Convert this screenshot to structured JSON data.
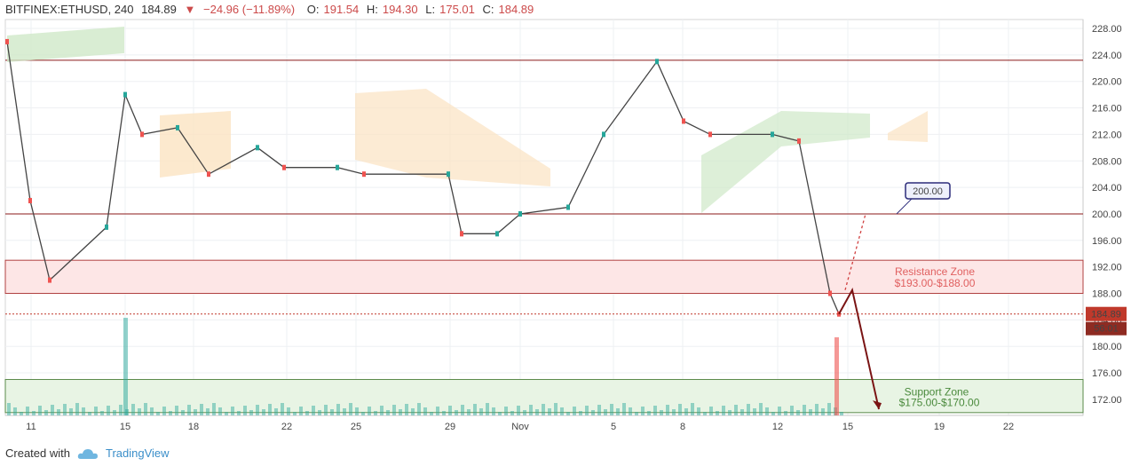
{
  "header": {
    "symbol": "BITFINEX:ETHUSD, 240",
    "last": "184.89",
    "change": "−24.96 (−11.89%)",
    "o_label": "O:",
    "o": "191.54",
    "h_label": "H:",
    "h": "194.30",
    "l_label": "L:",
    "l": "175.01",
    "c_label": "C:",
    "c": "184.89"
  },
  "footer": {
    "created_with": "Created with",
    "brand": "TradingView"
  },
  "colors": {
    "up": "#26a69a",
    "down": "#ef5350",
    "resistance_fill": "#fde6e6",
    "resistance_text": "#e06060",
    "support_fill": "#e8f4e4",
    "support_text": "#4a8a3c",
    "hline": "#8b1a1a",
    "price_tag": "#c0392b",
    "label_box": "#2b2b7a",
    "cloud_green": "#cfe8c8",
    "cloud_orange": "#fbe3c2"
  },
  "chart_data": {
    "type": "line",
    "title": "BITFINEX:ETHUSD, 240",
    "price_range": [
      168,
      229
    ],
    "y_ticks": [
      "228.00",
      "224.00",
      "220.00",
      "216.00",
      "212.00",
      "208.00",
      "204.00",
      "200.00",
      "196.00",
      "192.00",
      "188.00",
      "184.00",
      "180.00",
      "176.00",
      "172.00"
    ],
    "x_ticks": [
      "11",
      "15",
      "18",
      "22",
      "25",
      "29",
      "Nov",
      "5",
      "8",
      "12",
      "15",
      "19",
      "22"
    ],
    "current_price": {
      "value": 184.89,
      "label": "184.89",
      "countdown": "56:01"
    },
    "horizontal_levels": [
      223.2,
      200.0
    ],
    "resistance_zone": {
      "low": 188.0,
      "high": 193.0,
      "title": "Resistance Zone",
      "label": "$193.00-$188.00"
    },
    "support_zone": {
      "low": 170.0,
      "high": 175.0,
      "title": "Support Zone",
      "label": "$175.00-$170.00"
    },
    "target_label": {
      "value": 200.0,
      "text": "200.00"
    },
    "price_path": {
      "x": [
        "11",
        "11",
        "12",
        "15",
        "15",
        "15",
        "18",
        "18",
        "22",
        "22",
        "25",
        "25",
        "29",
        "29",
        "Nov",
        "Nov",
        "5",
        "5",
        "5",
        "8",
        "8",
        "12",
        "12",
        "14",
        "14"
      ],
      "close": [
        226,
        202,
        190,
        198,
        218,
        212,
        213,
        206,
        210,
        207,
        207,
        206,
        206,
        197,
        197,
        200,
        201,
        212,
        223,
        214,
        212,
        212,
        211,
        188,
        184.89
      ]
    },
    "projection": {
      "moves": [
        {
          "from": 184.89,
          "to": 188.5
        },
        {
          "from": 188.5,
          "to": 170.5
        }
      ],
      "alternative": {
        "from": 188.5,
        "to": 200.0
      }
    }
  }
}
